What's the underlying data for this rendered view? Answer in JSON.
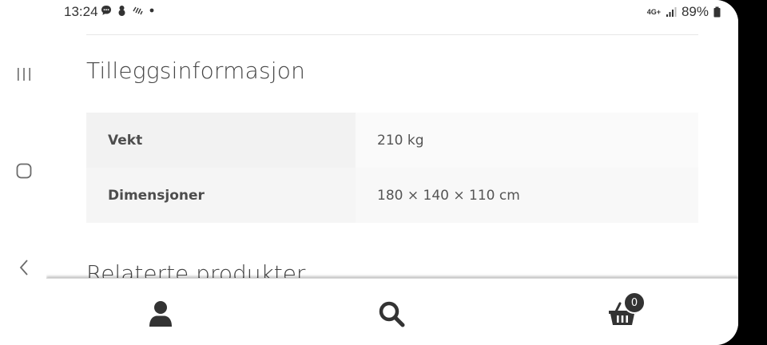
{
  "status_bar": {
    "time": "13:24",
    "left_icons": [
      "message-icon",
      "snowman-icon",
      "weather-icon",
      "dot-icon"
    ],
    "network_label": "4G+",
    "battery": "89%"
  },
  "nav_bar": {
    "recents": "recents-icon",
    "home": "home-icon",
    "back": "back-icon"
  },
  "product": {
    "additional_info_title": "Tilleggsinformasjon",
    "attributes": [
      {
        "label": "Vekt",
        "value": "210 kg"
      },
      {
        "label": "Dimensjoner",
        "value": "180 × 140 × 110 cm"
      }
    ],
    "related_title": "Relaterte produkter"
  },
  "footer": {
    "account_icon": "account-icon",
    "search_icon": "search-icon",
    "cart_icon": "basket-icon",
    "cart_count": "0"
  }
}
